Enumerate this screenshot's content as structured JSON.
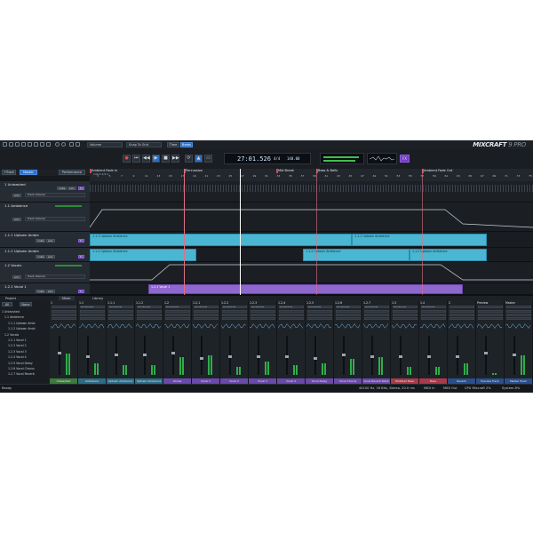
{
  "toolbar": {
    "dropdown_volume": "Volume",
    "dropdown_snap": "Snap To Grid",
    "btn_time": "Time",
    "btn_beats": "Beats",
    "logo_main": "MIXCRAFT",
    "logo_sub": "9 PRO"
  },
  "transport": {
    "time": "27:01.526",
    "signature": "4/4",
    "tempo": "140.00",
    "fx_label": "FX"
  },
  "tabs": {
    "track_label": "+Track",
    "master_label": "Master",
    "performance_label": "Performance"
  },
  "markers": [
    {
      "label": "Ambient Fade in"
    },
    {
      "label": "Percussion"
    },
    {
      "label": "Mid Break"
    },
    {
      "label": "Bass & Bells"
    },
    {
      "label": "Ambient Fade Out"
    }
  ],
  "ruler_sub": "140.0  4/4  C",
  "ticks": [
    "3",
    "5",
    "7",
    "9",
    "11",
    "13",
    "15",
    "17",
    "19",
    "21",
    "23",
    "25",
    "27",
    "29",
    "31",
    "33",
    "35",
    "37",
    "39",
    "41",
    "43",
    "45",
    "47",
    "49",
    "51",
    "53",
    "55",
    "57",
    "59",
    "61",
    "63",
    "65",
    "67",
    "69",
    "71",
    "73",
    "75"
  ],
  "tracks": {
    "t1": {
      "name": "1 Unleashed"
    },
    "t2": {
      "name": "1.1 Ambience",
      "dropdown": "Track Volume"
    },
    "t3": {
      "name": "1.1.1 Uptown Ambie",
      "dropdown": "Track Volume"
    },
    "t4": {
      "name": "1.1.2 Uptown Ambie"
    },
    "t5": {
      "name": "1.2 Vocals",
      "dropdown": "Track Volume"
    },
    "t6": {
      "name": "1.2.1 Vocal 1"
    }
  },
  "track_buttons": {
    "mute": "mute",
    "solo": "solo",
    "arm": "arm",
    "fx": "fx"
  },
  "clips": {
    "c1": "1.1.1 Uptown Ambience",
    "c2": "1.1.1 Uptown Ambience",
    "c3": "1.1.2 Uptown Ambience",
    "c4": "1.1.2 Uptown Ambience",
    "c5": "1.1.2 Uptown Ambience",
    "c6": "1.2.1 Vocal 1"
  },
  "mixer_tabs": [
    "Project",
    "Mixer",
    "Library"
  ],
  "project_header": {
    "all": "All",
    "none": "None"
  },
  "project_items": [
    "1 Unleashed",
    "1.1 Ambience",
    "1.1.1 Uptown Ambi",
    "1.1.2 Uptown Ambi",
    "1.2 Vocals",
    "1.2.1 Vocal 1",
    "1.2.2 Vocal 2",
    "1.2.3 Vocal 3",
    "1.2.4 Vocal 4",
    "1.2.5 Vocal Delay",
    "1.2.6 Vocal Chorus",
    "1.2.7 Vocal Reverb"
  ],
  "strip_heads": [
    "1",
    "1.1",
    "1.1.1",
    "1.1.2",
    "1.2",
    "1.2.1",
    "1.2.2",
    "1.2.3",
    "1.2.4",
    "1.2.5",
    "1.2.6",
    "1.2.7",
    "1.3",
    "1.4",
    "2",
    "Preview",
    "Master"
  ],
  "strip_slot": "Microphone",
  "strips": [
    {
      "name": "Unleashed",
      "color": "#3d7a3d"
    },
    {
      "name": "Ambience",
      "color": "#2e6c86"
    },
    {
      "name": "Uptown Ambience",
      "color": "#2e6c86"
    },
    {
      "name": "Uptown Ambience",
      "color": "#2e6c86"
    },
    {
      "name": "Vocals",
      "color": "#6a4aa8"
    },
    {
      "name": "Vocal 1",
      "color": "#6a4aa8"
    },
    {
      "name": "Vocal 2",
      "color": "#6a4aa8"
    },
    {
      "name": "Vocal 3",
      "color": "#6a4aa8"
    },
    {
      "name": "Vocal 4",
      "color": "#6a4aa8"
    },
    {
      "name": "Vocal Delay",
      "color": "#6a4aa8"
    },
    {
      "name": "Vocal Chorus",
      "color": "#6a4aa8"
    },
    {
      "name": "Vocal Reverb Wash",
      "color": "#6a4aa8"
    },
    {
      "name": "Wobbled Bass",
      "color": "#a83a4a"
    },
    {
      "name": "Bass",
      "color": "#a83a4a"
    },
    {
      "name": "Reverb",
      "color": "#2b4f8a"
    },
    {
      "name": "Preview Track",
      "color": "#2b4f8a"
    },
    {
      "name": "Master Track",
      "color": "#2b4f8a"
    }
  ],
  "status": {
    "ready": "Ready",
    "format": "44100 Hz, 16 Bits, Stereo, 20.0 ms",
    "midi_in": "MIDI In",
    "midi_out": "MIDI Out",
    "cpu": "CPU Mixcraft 2%",
    "system": "System 8%"
  }
}
